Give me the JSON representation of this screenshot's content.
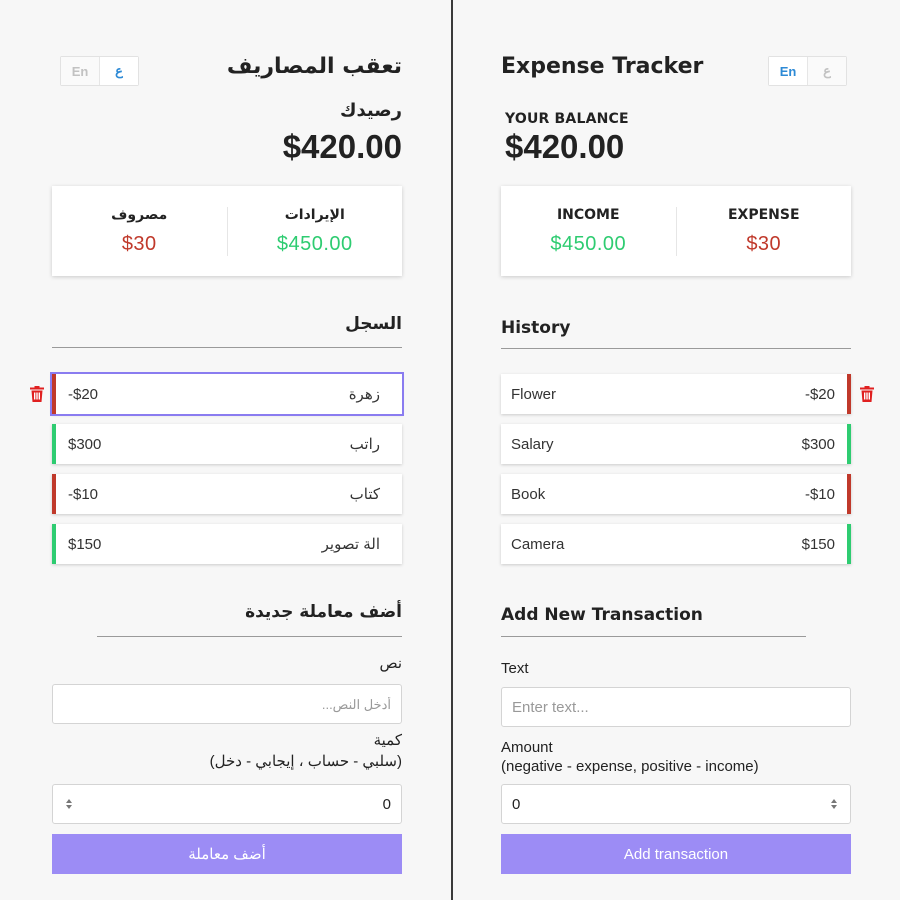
{
  "colors": {
    "income": "#2ecc71",
    "expense": "#c0392b",
    "accent_button": "#9c8cf5",
    "delete_icon": "#e02020"
  },
  "arabic": {
    "lang_toggle": {
      "en": "En",
      "ar": "ع"
    },
    "title": "تعقب المصاريف",
    "balance_label": "رصيدك",
    "balance_amount": "$420.00",
    "income_label": "الإيرادات",
    "income_value": "$450.00",
    "expense_label": "مصروف",
    "expense_value": "$30",
    "history_title": "السجل",
    "transactions": [
      {
        "text": "زهرة",
        "amount": "-$20",
        "type": "expense"
      },
      {
        "text": "راتب",
        "amount": "$300",
        "type": "income"
      },
      {
        "text": "كتاب",
        "amount": "-$10",
        "type": "expense"
      },
      {
        "text": "الة تصوير",
        "amount": "$150",
        "type": "income"
      }
    ],
    "add_title": "أضف معاملة جديدة",
    "text_label": "نص",
    "text_placeholder": "أدخل النص...",
    "amount_label": "كمية",
    "amount_hint": "(سلبي - حساب ، إيجابي - دخل)",
    "amount_value": "0",
    "submit_label": "أضف معاملة"
  },
  "english": {
    "lang_toggle": {
      "en": "En",
      "ar": "ع"
    },
    "title": "Expense Tracker",
    "balance_label": "YOUR BALANCE",
    "balance_amount": "$420.00",
    "income_label": "INCOME",
    "income_value": "$450.00",
    "expense_label": "EXPENSE",
    "expense_value": "$30",
    "history_title": "History",
    "transactions": [
      {
        "text": "Flower",
        "amount": "-$20",
        "type": "expense"
      },
      {
        "text": "Salary",
        "amount": "$300",
        "type": "income"
      },
      {
        "text": "Book",
        "amount": "-$10",
        "type": "expense"
      },
      {
        "text": "Camera",
        "amount": "$150",
        "type": "income"
      }
    ],
    "add_title": "Add New Transaction",
    "text_label": "Text",
    "text_placeholder": "Enter text...",
    "amount_label": "Amount",
    "amount_hint": "(negative - expense, positive - income)",
    "amount_value": "0",
    "submit_label": "Add transaction"
  }
}
